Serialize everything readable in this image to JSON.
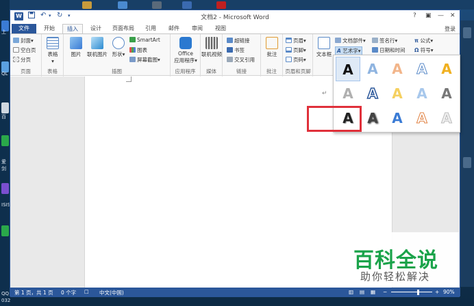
{
  "desktop": {
    "labels": [
      "上",
      "QL",
      "百",
      "爱剑",
      "ISIS",
      "QQ",
      "032"
    ]
  },
  "titlebar": {
    "title": "文档2 - Microsoft Word",
    "help": "?",
    "restore": "▣",
    "minimize": "—",
    "close": "✕"
  },
  "tabs": [
    "文件",
    "开始",
    "插入",
    "设计",
    "页面布局",
    "引用",
    "邮件",
    "审阅",
    "视图"
  ],
  "login": "登录",
  "ribbon": {
    "pages": {
      "items": [
        "封面",
        "空白页",
        "分页"
      ],
      "label": "页面"
    },
    "tables": {
      "item": "表格",
      "label": "表格"
    },
    "illustrations": {
      "items": [
        "图片",
        "联机图片",
        "形状"
      ],
      "smartart": "SmartArt",
      "chart": "图表",
      "screenshot": "屏幕截图",
      "label": "插图"
    },
    "apps": {
      "item_line1": "Office",
      "item_line2": "应用程序",
      "label": "应用程序"
    },
    "media": {
      "item": "联机视频",
      "label": "媒体"
    },
    "links": {
      "items": [
        "超链接",
        "书签",
        "交叉引用"
      ],
      "label": "链接"
    },
    "comments": {
      "item": "批注",
      "label": "批注"
    },
    "header_footer": {
      "items": [
        "页眉",
        "页脚",
        "页码"
      ],
      "label": "页眉和页脚"
    },
    "text": {
      "textbox": "文本框",
      "items": [
        "文档部件",
        "艺术字"
      ],
      "signature": "签名行",
      "datetime": "日期和时间"
    },
    "symbols": {
      "items": [
        "公式",
        "符号"
      ]
    }
  },
  "wordart": {
    "glyph": "A"
  },
  "statusbar": {
    "page": "第 1 页，共 1 页",
    "words": "0 个字",
    "language": "中文(中国)",
    "zoom": "90%"
  },
  "watermark": {
    "title": "百科全说",
    "subtitle": "助你轻松解决"
  }
}
